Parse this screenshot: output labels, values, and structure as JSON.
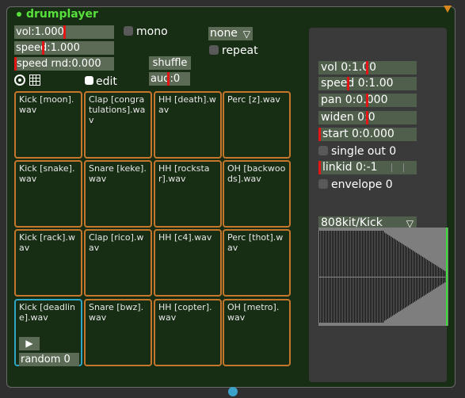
{
  "window": {
    "title": "drumplayer"
  },
  "controls": {
    "vol": "vol:1.000",
    "speed": "speed:1.000",
    "speed_rnd": "speed rnd:0.000",
    "mono": "mono",
    "none_dropdown": "none",
    "repeat": "repeat",
    "shuffle": "shuffle",
    "aud": "aud:0",
    "edit": "edit"
  },
  "pads": [
    {
      "text": "Kick [moon].wav"
    },
    {
      "text": "Clap [congratulations].wav"
    },
    {
      "text": "HH [death].wav"
    },
    {
      "text": "Perc [z].wav"
    },
    {
      "text": "Kick [snake].wav"
    },
    {
      "text": "Snare [keke].wav"
    },
    {
      "text": "HH [rockstar].wav"
    },
    {
      "text": "OH [backwoods].wav"
    },
    {
      "text": "Kick [rack].wav"
    },
    {
      "text": "Clap [rico].wav"
    },
    {
      "text": "HH [c4].wav"
    },
    {
      "text": "Perc [thot].wav"
    },
    {
      "text": "Kick [deadline].wav"
    },
    {
      "text": "Snare [bwz].wav"
    },
    {
      "text": "HH [copter].wav"
    },
    {
      "text": "OH [metro].wav"
    }
  ],
  "pad13": {
    "random": "random 0",
    "play": "▶"
  },
  "panel": {
    "vol": "vol 0:1.00",
    "speed": "speed 0:1.00",
    "pan": "pan 0:0.000",
    "widen": "widen 0:0",
    "start": "start 0:0.000",
    "single_out": "single out 0",
    "linkid": "linkid 0:-1",
    "envelope": "envelope 0",
    "kit": "808kit/Kick"
  },
  "colors": {
    "accent": "#57e03b",
    "pad_border": "#c5762a",
    "selected": "#2fa6c6",
    "slider_mark": "#e31515"
  }
}
